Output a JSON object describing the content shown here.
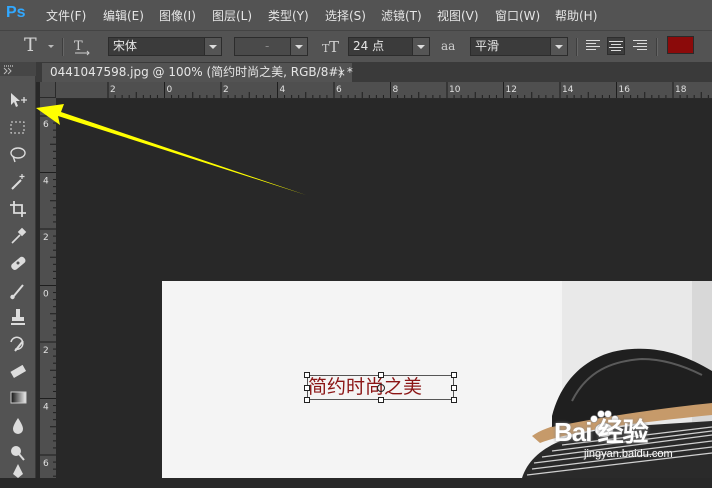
{
  "app": {
    "logo": "Ps",
    "menus": [
      "文件(F)",
      "编辑(E)",
      "图像(I)",
      "图层(L)",
      "类型(Y)",
      "选择(S)",
      "滤镜(T)",
      "视图(V)",
      "窗口(W)",
      "帮助(H)"
    ]
  },
  "options": {
    "tool_icon": "T",
    "orientation_icon": "text-orientation-icon",
    "font_family": "宋体",
    "font_style": "-",
    "size_icon": "font-size-icon",
    "font_size": "24 点",
    "aa_icon": "aa",
    "antialias": "平滑",
    "align": [
      "align-left",
      "align-center",
      "align-right"
    ],
    "text_color": "#8b0a0a"
  },
  "document": {
    "tab_title": "0441047598.jpg @ 100% (简约时尚之美, RGB/8#) *",
    "close": "×"
  },
  "rulers": {
    "horizontal_labels": [
      "2",
      "0",
      "2",
      "4",
      "6",
      "8",
      "10",
      "12",
      "14",
      "16",
      "18"
    ],
    "vertical_labels": [
      "6",
      "4",
      "2",
      "0",
      "2",
      "4",
      "6"
    ]
  },
  "canvas": {
    "text_layer": "简约时尚之美",
    "text_color": "#8b1515"
  },
  "watermark": {
    "brand": "Bai 经验",
    "url": "jingyan.baidu.com"
  },
  "tools": [
    "move-tool-icon",
    "marquee-tool-icon",
    "lasso-tool-icon",
    "magic-wand-tool-icon",
    "crop-tool-icon",
    "eyedropper-tool-icon",
    "healing-brush-tool-icon",
    "brush-tool-icon",
    "clone-stamp-tool-icon",
    "history-brush-tool-icon",
    "eraser-tool-icon",
    "gradient-tool-icon",
    "blur-tool-icon",
    "dodge-tool-icon",
    "pen-tool-icon"
  ],
  "annotation": {
    "arrow_color": "#ffff00"
  }
}
